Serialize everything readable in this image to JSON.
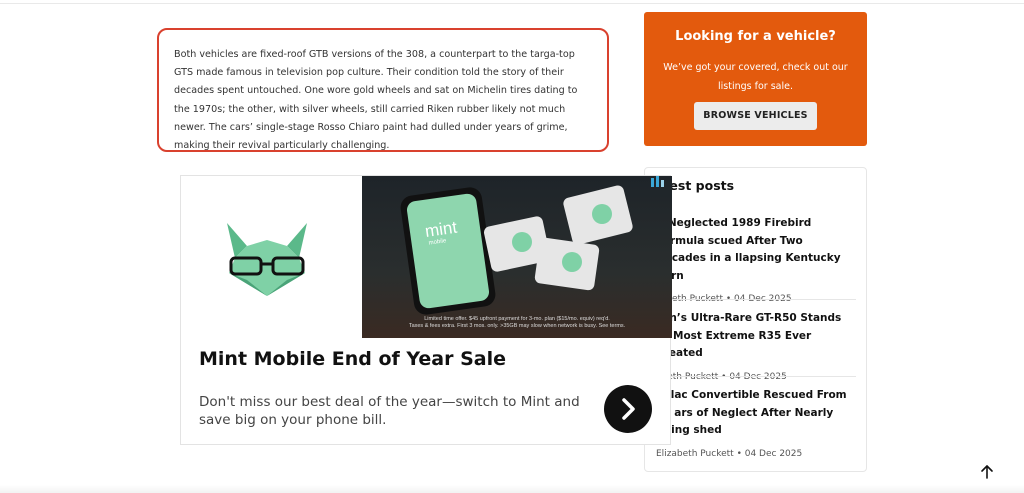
{
  "article": {
    "paragraph": "Both vehicles are fixed-roof GTB versions of the 308, a counterpart to the targa-top GTS made famous in television pop culture. Their condition told the story of their decades spent untouched. One wore gold wheels and sat on Michelin tires dating to the 1970s; the other, with silver wheels, still carried Riken rubber likely not much newer. The cars’ single-stage Rosso Chiaro paint had dulled under years of grime, making their revival particularly challenging."
  },
  "cta": {
    "title": "Looking for a vehicle?",
    "description": "We’ve got your covered, check out our listings for sale.",
    "button_label": "BROWSE VEHICLES",
    "bg_color": "#e35a0d"
  },
  "latest_posts": {
    "heading": "atest posts",
    "posts": [
      {
        "title": "g-Neglected 1989 Firebird Formula scued After Two Decades in a llapsing Kentucky Barn",
        "author": "zabeth Puckett",
        "date": "04 Dec 2025"
      },
      {
        "title": "san’s Ultra-Rare GT-R50 Stands as Most Extreme R35 Ever Created",
        "author": "abeth Puckett",
        "date": "04 Dec 2025"
      },
      {
        "title": "dillac Convertible Rescued From 50 ars of Neglect After Nearly Being shed",
        "author": "Elizabeth Puckett",
        "date": "04 Dec 2025"
      }
    ]
  },
  "ad": {
    "headline": "Mint Mobile End of Year Sale",
    "body": "Don't miss our best deal of the year—switch to Mint and save big on your phone bill.",
    "fine_print_1": "Limited time offer. $45 upfront payment for 3-mo. plan ($15/mo. equiv) req'd.",
    "fine_print_2": "Taxes & fees extra. First 3 mos. only. >35GB may slow when network is busy. See terms.",
    "phone_brand": "mint",
    "phone_sub": "mobile",
    "brand_color": "#6fcf97"
  },
  "icons": {
    "go": "chevron-right-icon",
    "scroll": "arrow-up-icon",
    "adchoices": "adchoices-icon"
  }
}
